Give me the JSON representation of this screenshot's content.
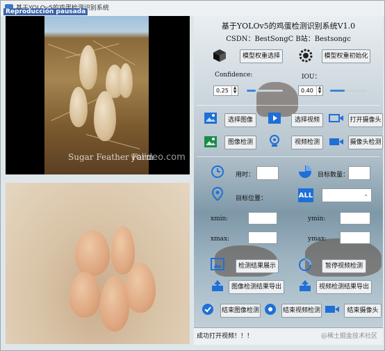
{
  "window": {
    "title": "基于YOLOv5的鸡蛋检测识别系统",
    "badge": "Reproducción pausada"
  },
  "left": {
    "watermark_left": "Sugar Feather Farm",
    "watermark_right": "yolideo.com"
  },
  "header": {
    "title": "基于YOLOv5的鸡蛋检测识别系统V1.0",
    "subtitle": "CSDN：BestSongC  B站：Bestsongc"
  },
  "model": {
    "select_label": "模型权重选择",
    "init_label": "模型权重初始化"
  },
  "params": {
    "confidence_label": "Confidence:",
    "iou_label": "IOU：",
    "confidence_value": "0.25",
    "iou_value": "0.40",
    "confidence_fill": 0.25,
    "iou_fill": 0.4
  },
  "actions": {
    "select_image": "选择图像",
    "select_video": "选择视频",
    "open_camera": "打开摄像头",
    "image_detect": "图像检测",
    "video_detect": "视频检测",
    "camera_detect": "摄像头检测"
  },
  "results": {
    "time_label": "用时：",
    "count_label": "目标数量：",
    "location_label": "目标位置：",
    "select_all": "ALL",
    "xmin_label": "xmin:",
    "ymin_label": "ymin:",
    "xmax_label": "xmax:",
    "ymax_label": "ymax:"
  },
  "controls": {
    "show_results": "检测结果展示",
    "pause_video": "暂停视频检测",
    "export_image": "图像检测结果导出",
    "export_video": "视频检测结果导出",
    "end_image": "结束图像检测",
    "end_video": "结束视频检测",
    "end_camera": "结束摄像头"
  },
  "status": {
    "text": "成功打开视频！！！"
  },
  "watermark": "@稀土掘金技术社区",
  "colors": {
    "accent": "#3a86d9",
    "icon_blue": "#1f6fd6"
  }
}
